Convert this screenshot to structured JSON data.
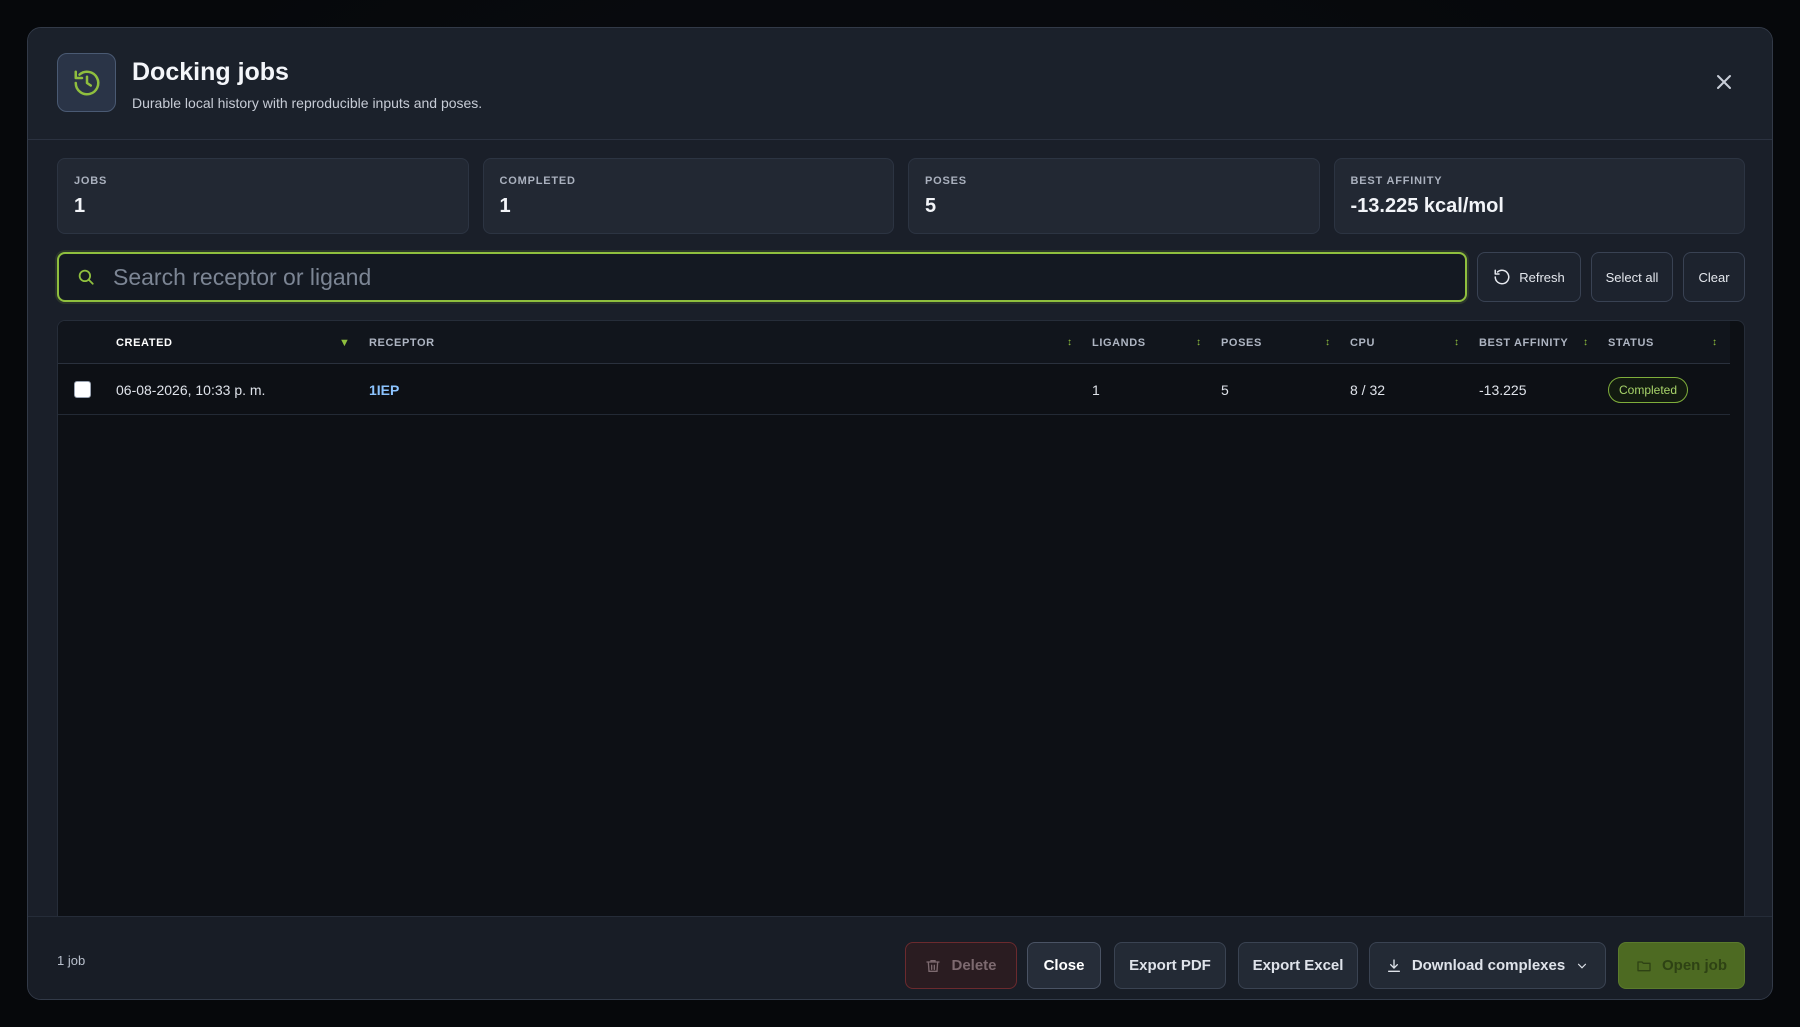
{
  "header": {
    "title": "Docking jobs",
    "subtitle": "Durable local history with reproducible inputs and poses."
  },
  "stats": [
    {
      "label": "JOBS",
      "value": "1"
    },
    {
      "label": "COMPLETED",
      "value": "1"
    },
    {
      "label": "POSES",
      "value": "5"
    },
    {
      "label": "BEST AFFINITY",
      "value": "-13.225 kcal/mol"
    }
  ],
  "search": {
    "placeholder": "Search receptor or ligand",
    "value": ""
  },
  "toolbar": {
    "refresh_label": "Refresh",
    "select_all_label": "Select all",
    "clear_label": "Clear"
  },
  "table": {
    "columns": [
      "CREATED",
      "RECEPTOR",
      "LIGANDS",
      "POSES",
      "CPU",
      "BEST AFFINITY",
      "STATUS"
    ],
    "sort_column": "CREATED",
    "rows": [
      {
        "created": "06-08-2026, 10:33 p. m.",
        "receptor": "1IEP",
        "ligands": "1",
        "poses": "5",
        "cpu": "8 / 32",
        "best_affinity": "-13.225",
        "status": "Completed"
      }
    ]
  },
  "footer": {
    "count": "1 job",
    "delete_label": "Delete",
    "close_label": "Close",
    "export_pdf_label": "Export PDF",
    "export_excel_label": "Export Excel",
    "download_label": "Download complexes",
    "open_label": "Open job"
  },
  "colors": {
    "accent": "#8fbf3e",
    "link": "#8cc4ff",
    "danger": "#6b2a2e"
  }
}
